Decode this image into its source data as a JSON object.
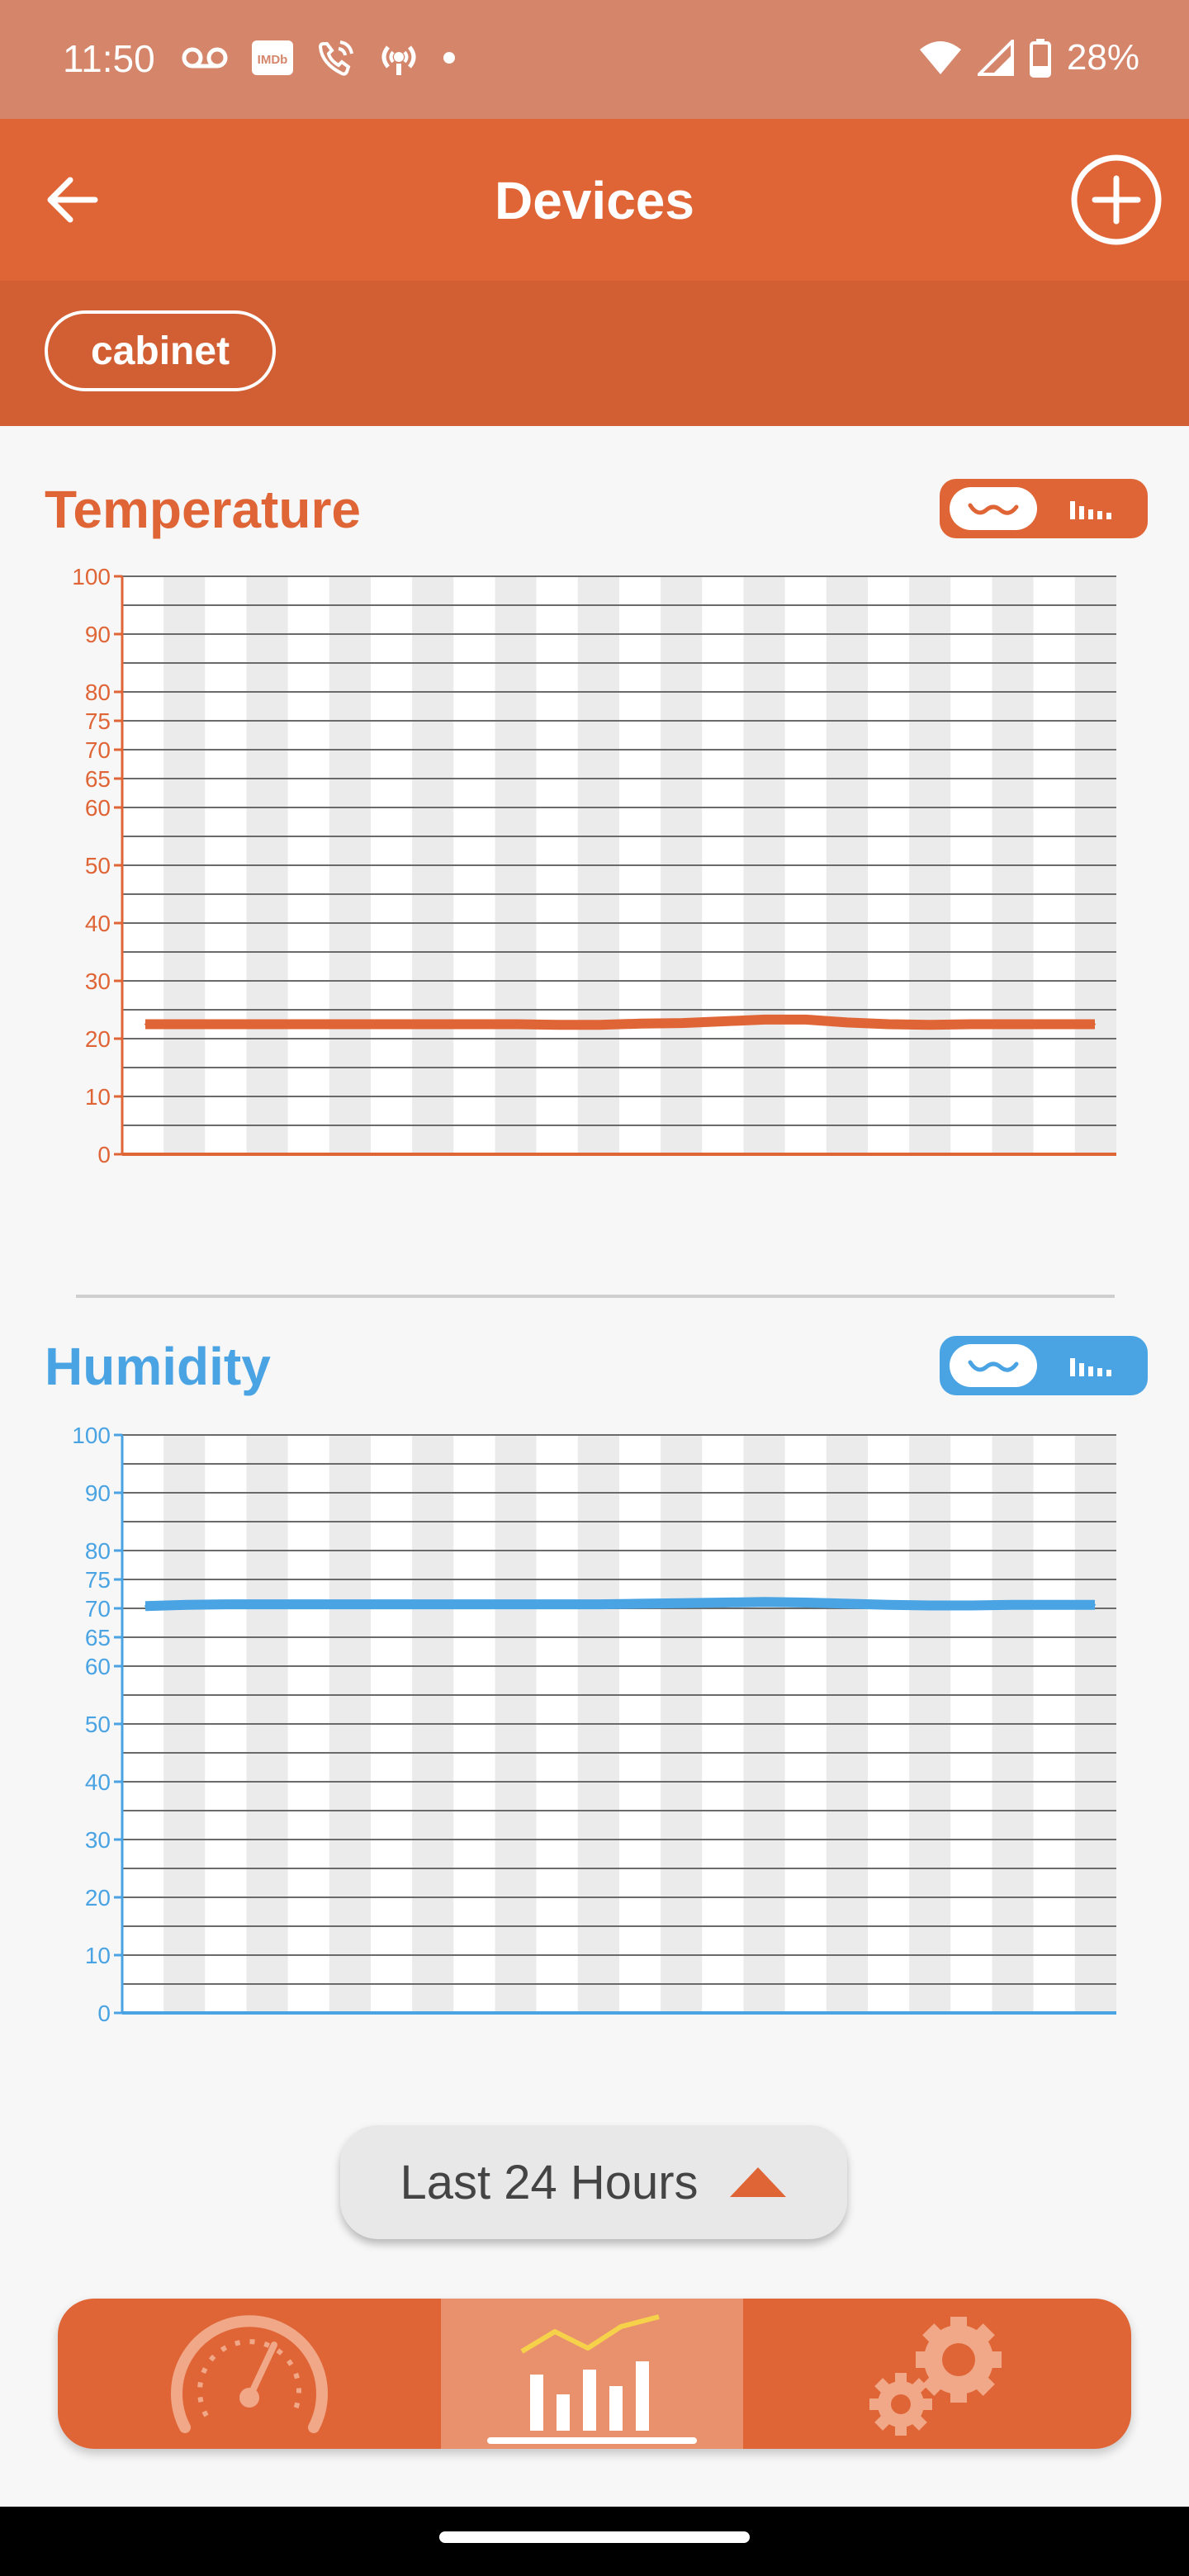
{
  "status_bar": {
    "time": "11:50",
    "battery": "28%",
    "imdb_badge": "IMDb"
  },
  "app_bar": {
    "title": "Devices"
  },
  "filter": {
    "chip_label": "cabinet"
  },
  "temperature": {
    "title": "Temperature",
    "color": "#e06536"
  },
  "humidity": {
    "title": "Humidity",
    "color": "#4aa3e3"
  },
  "time_range": {
    "label": "Last 24 Hours"
  },
  "chart_data": [
    {
      "type": "line",
      "title": "Temperature",
      "ylim": [
        0,
        100
      ],
      "y_ticks": [
        0,
        10,
        20,
        30,
        40,
        50,
        60,
        65,
        70,
        75,
        80,
        90,
        100
      ],
      "series": [
        {
          "values": [
            22.5,
            22.5,
            22.5,
            22.5,
            22.5,
            22.5,
            22.5,
            22.5,
            22.5,
            22.5,
            22.4,
            22.4,
            22.6,
            22.7,
            23.0,
            23.3,
            23.3,
            22.8,
            22.5,
            22.4,
            22.5,
            22.5,
            22.5,
            22.5
          ]
        }
      ]
    },
    {
      "type": "line",
      "title": "Humidity",
      "ylim": [
        0,
        100
      ],
      "y_ticks": [
        0,
        10,
        20,
        30,
        40,
        50,
        60,
        65,
        70,
        75,
        80,
        90,
        100
      ],
      "series": [
        {
          "values": [
            70.4,
            70.6,
            70.7,
            70.7,
            70.7,
            70.7,
            70.7,
            70.7,
            70.7,
            70.7,
            70.7,
            70.7,
            70.8,
            70.9,
            71.0,
            71.1,
            71.0,
            70.8,
            70.6,
            70.5,
            70.5,
            70.6,
            70.6,
            70.6
          ]
        }
      ]
    }
  ]
}
